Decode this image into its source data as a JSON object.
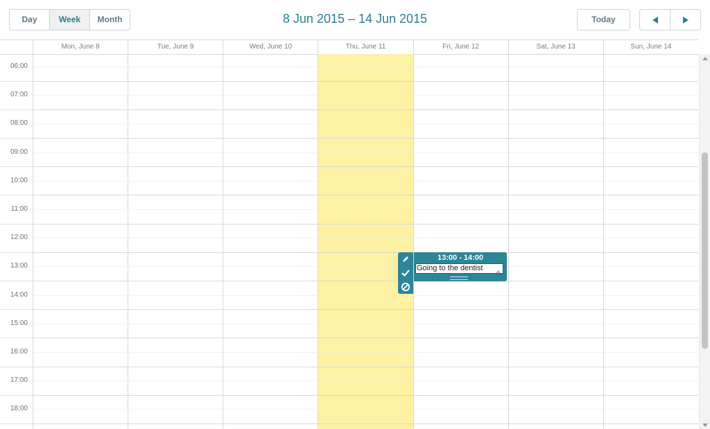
{
  "toolbar": {
    "views": [
      "Day",
      "Week",
      "Month"
    ],
    "active_view": "Week",
    "date_range": "8 Jun 2015 – 14 Jun 2015",
    "today_label": "Today",
    "prev_icon": "triangle-left-icon",
    "next_icon": "triangle-right-icon"
  },
  "days": [
    "Mon, June 8",
    "Tue, June 9",
    "Wed, June 10",
    "Thu, June 11",
    "Fri, June 12",
    "Sat, June 13",
    "Sun, June 14"
  ],
  "today_index": 3,
  "times": [
    "06:00",
    "07:00",
    "08:00",
    "09:00",
    "10:00",
    "11:00",
    "12:00",
    "13:00",
    "14:00",
    "15:00",
    "16:00",
    "17:00",
    "18:00"
  ],
  "event": {
    "time": "13:00 - 14:00",
    "text": "Going to the dentist",
    "tools": [
      "pencil-icon",
      "check-icon",
      "cancel-icon"
    ]
  },
  "colors": {
    "accent": "#2b7f8f",
    "event": "#2d8596",
    "today_highlight": "#fdf1a3"
  }
}
